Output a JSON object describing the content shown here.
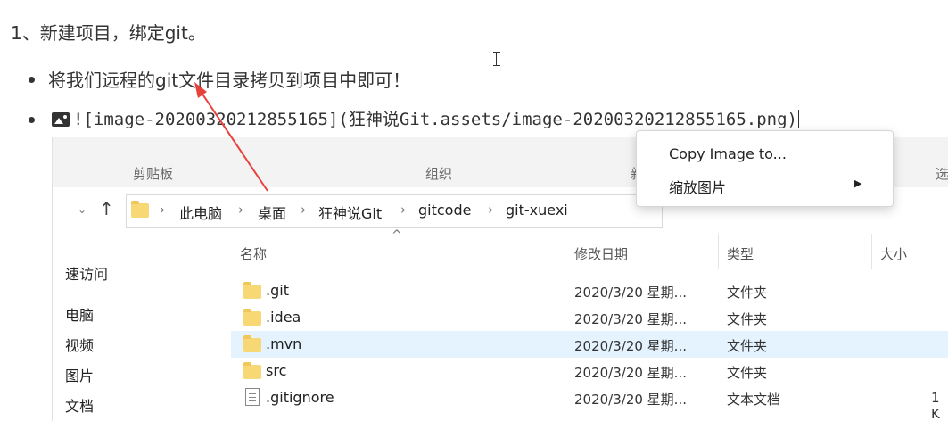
{
  "doc": {
    "heading": "1、新建项目，绑定git。",
    "bullet1": "将我们远程的git文件目录拷贝到项目中即可！",
    "bullet2_md": "![image-20200320212855165](狂神说Git.assets/image-20200320212855165.png)"
  },
  "explorer": {
    "ribbon": [
      "剪贴板",
      "组织",
      "新",
      "选"
    ],
    "breadcrumb": [
      "此电脑",
      "桌面",
      "狂神说Git",
      "gitcode",
      "git-xuexi"
    ],
    "columns": [
      "名称",
      "修改日期",
      "类型",
      "大小"
    ],
    "nav_pane": [
      "速访问",
      "电脑",
      "视频",
      "图片",
      "文档"
    ],
    "files": [
      {
        "name": ".git",
        "date": "2020/3/20 星期...",
        "type": "文件夹",
        "size": ""
      },
      {
        "name": ".idea",
        "date": "2020/3/20 星期...",
        "type": "文件夹",
        "size": ""
      },
      {
        "name": ".mvn",
        "date": "2020/3/20 星期...",
        "type": "文件夹",
        "size": ""
      },
      {
        "name": "src",
        "date": "2020/3/20 星期...",
        "type": "文件夹",
        "size": ""
      },
      {
        "name": ".gitignore",
        "date": "2020/3/20 星期...",
        "type": "文本文档",
        "size": "1 K"
      }
    ]
  },
  "context_menu": {
    "items": [
      "Copy Image to...",
      "缩放图片"
    ]
  },
  "colors": {
    "arrow": "#e8403a",
    "selected_row": "#e5f3ff",
    "folder": "#f8d775"
  }
}
